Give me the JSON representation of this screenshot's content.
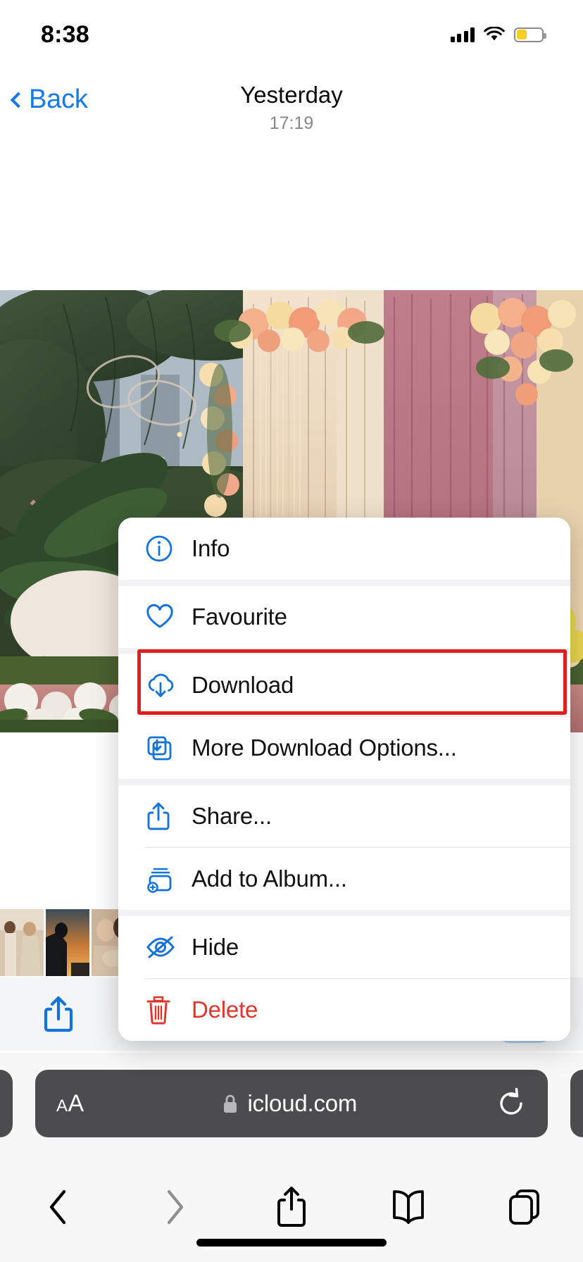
{
  "status_bar": {
    "time": "8:38",
    "signal_icon": "cellular-signal-icon",
    "wifi_icon": "wifi-icon",
    "battery_icon": "battery-low-power-icon",
    "battery_color": "#f7cf22"
  },
  "nav_bar": {
    "back_label": "Back",
    "back_icon": "chevron-left-icon",
    "title": "Yesterday",
    "subtitle": "17:19",
    "accent_color": "#1579e8"
  },
  "photo": {
    "alt": "wedding-backdrop-photo",
    "description": "Floral wedding backdrop with cream and mauve drapes, roses, greenery and fairy lights"
  },
  "thumbnails": [
    {
      "name": "thumbnail-couple-holding-hands"
    },
    {
      "name": "thumbnail-sunset-silhouette"
    },
    {
      "name": "thumbnail-couple-closeup"
    },
    {
      "name": "thumbnail-couple-embrace"
    }
  ],
  "photo_toolbar": {
    "buttons": [
      {
        "name": "share-button",
        "icon": "share-icon",
        "active": false
      },
      {
        "name": "favourite-button",
        "icon": "heart-icon",
        "active": false
      },
      {
        "name": "info-button",
        "icon": "info-circle-icon",
        "active": false
      },
      {
        "name": "delete-button",
        "icon": "trash-icon",
        "active": false
      },
      {
        "name": "more-button",
        "icon": "ellipsis-circle-icon",
        "active": true
      }
    ],
    "icon_color": "#1572d6",
    "active_background": "#a9cdf2",
    "background": "#f4f5f7"
  },
  "context_menu": {
    "items": [
      {
        "label": "Info",
        "icon": "info-circle-icon",
        "style": "normal",
        "group": 0
      },
      {
        "label": "Favourite",
        "icon": "heart-icon",
        "style": "normal",
        "group": 1
      },
      {
        "label": "Download",
        "icon": "cloud-download-icon",
        "style": "normal",
        "group": 2,
        "highlighted": true
      },
      {
        "label": "More Download Options...",
        "icon": "download-stack-icon",
        "style": "normal",
        "group": 2
      },
      {
        "label": "Share...",
        "icon": "share-icon",
        "style": "normal",
        "group": 3
      },
      {
        "label": "Add to Album...",
        "icon": "add-to-album-icon",
        "style": "normal",
        "group": 3
      },
      {
        "label": "Hide",
        "icon": "eye-slash-icon",
        "style": "normal",
        "group": 4
      },
      {
        "label": "Delete",
        "icon": "trash-icon",
        "style": "destructive",
        "group": 4
      }
    ],
    "icon_color": "#1572d6",
    "destructive_color": "#e0352b",
    "background": "#ffffff"
  },
  "annotation": {
    "type": "highlight-rectangle",
    "target": "Download",
    "color": "#e01f1f"
  },
  "browser": {
    "text_size_label_small": "A",
    "text_size_label_large": "A",
    "text_size_button": "aA",
    "lock_icon": "lock-icon",
    "url": "icloud.com",
    "reload_icon": "reload-icon",
    "urlbar_background": "#4c4c4e",
    "nav_buttons": [
      {
        "name": "back-button",
        "icon": "chevron-left-icon",
        "enabled": true
      },
      {
        "name": "forward-button",
        "icon": "chevron-right-icon",
        "enabled": false
      },
      {
        "name": "share-button",
        "icon": "share-icon",
        "enabled": true
      },
      {
        "name": "bookmarks-button",
        "icon": "book-icon",
        "enabled": true
      },
      {
        "name": "tabs-button",
        "icon": "tabs-icon",
        "enabled": true
      }
    ]
  }
}
